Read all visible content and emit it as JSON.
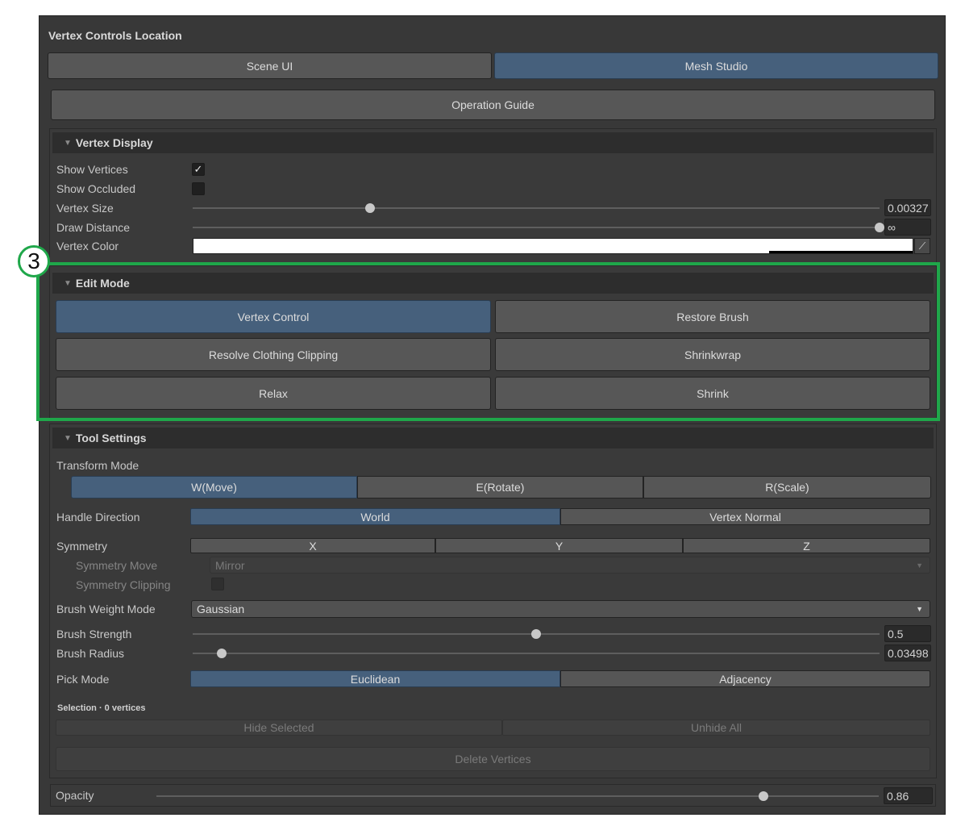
{
  "header": {
    "title": "Vertex Controls Location"
  },
  "location_tabs": [
    {
      "label": "Scene UI",
      "selected": false
    },
    {
      "label": "Mesh Studio",
      "selected": true
    }
  ],
  "operation_guide_label": "Operation Guide",
  "vertex_display": {
    "title": "Vertex Display",
    "show_vertices_label": "Show Vertices",
    "show_vertices_checked": true,
    "show_occluded_label": "Show Occluded",
    "show_occluded_checked": false,
    "vertex_size_label": "Vertex Size",
    "vertex_size_value": "0.00327",
    "vertex_size_fraction": 0.258,
    "draw_distance_label": "Draw Distance",
    "draw_distance_value": "∞",
    "draw_distance_fraction": 1.0,
    "vertex_color_label": "Vertex Color",
    "vertex_color": "#ffffff"
  },
  "callout": {
    "number": "3",
    "color": "#1fa74a"
  },
  "edit_mode": {
    "title": "Edit Mode",
    "buttons": [
      {
        "label": "Vertex Control",
        "selected": true
      },
      {
        "label": "Restore Brush",
        "selected": false
      },
      {
        "label": "Resolve Clothing Clipping",
        "selected": false
      },
      {
        "label": "Shrinkwrap",
        "selected": false
      },
      {
        "label": "Relax",
        "selected": false
      },
      {
        "label": "Shrink",
        "selected": false
      }
    ]
  },
  "tool_settings": {
    "title": "Tool Settings",
    "transform_mode_label": "Transform Mode",
    "transform_modes": [
      {
        "label": "W(Move)",
        "selected": true
      },
      {
        "label": "E(Rotate)",
        "selected": false
      },
      {
        "label": "R(Scale)",
        "selected": false
      }
    ],
    "handle_direction_label": "Handle Direction",
    "handle_directions": [
      {
        "label": "World",
        "selected": true
      },
      {
        "label": "Vertex Normal",
        "selected": false
      }
    ],
    "symmetry_label": "Symmetry",
    "symmetry_axes": [
      {
        "label": "X",
        "selected": false
      },
      {
        "label": "Y",
        "selected": false
      },
      {
        "label": "Z",
        "selected": false
      }
    ],
    "symmetry_move_label": "Symmetry Move",
    "symmetry_move_value": "Mirror",
    "symmetry_clipping_label": "Symmetry Clipping",
    "symmetry_clipping_checked": false,
    "brush_weight_mode_label": "Brush Weight Mode",
    "brush_weight_mode_value": "Gaussian",
    "brush_strength_label": "Brush Strength",
    "brush_strength_value": "0.5",
    "brush_strength_fraction": 0.5,
    "brush_radius_label": "Brush Radius",
    "brush_radius_value": "0.03498",
    "brush_radius_fraction": 0.042,
    "pick_mode_label": "Pick Mode",
    "pick_modes": [
      {
        "label": "Euclidean",
        "selected": true
      },
      {
        "label": "Adjacency",
        "selected": false
      }
    ],
    "selection_label": "Selection · 0 vertices",
    "hide_selected_label": "Hide Selected",
    "unhide_all_label": "Unhide All",
    "delete_vertices_label": "Delete Vertices"
  },
  "opacity": {
    "label": "Opacity",
    "value": "0.86",
    "fraction": 0.84
  }
}
